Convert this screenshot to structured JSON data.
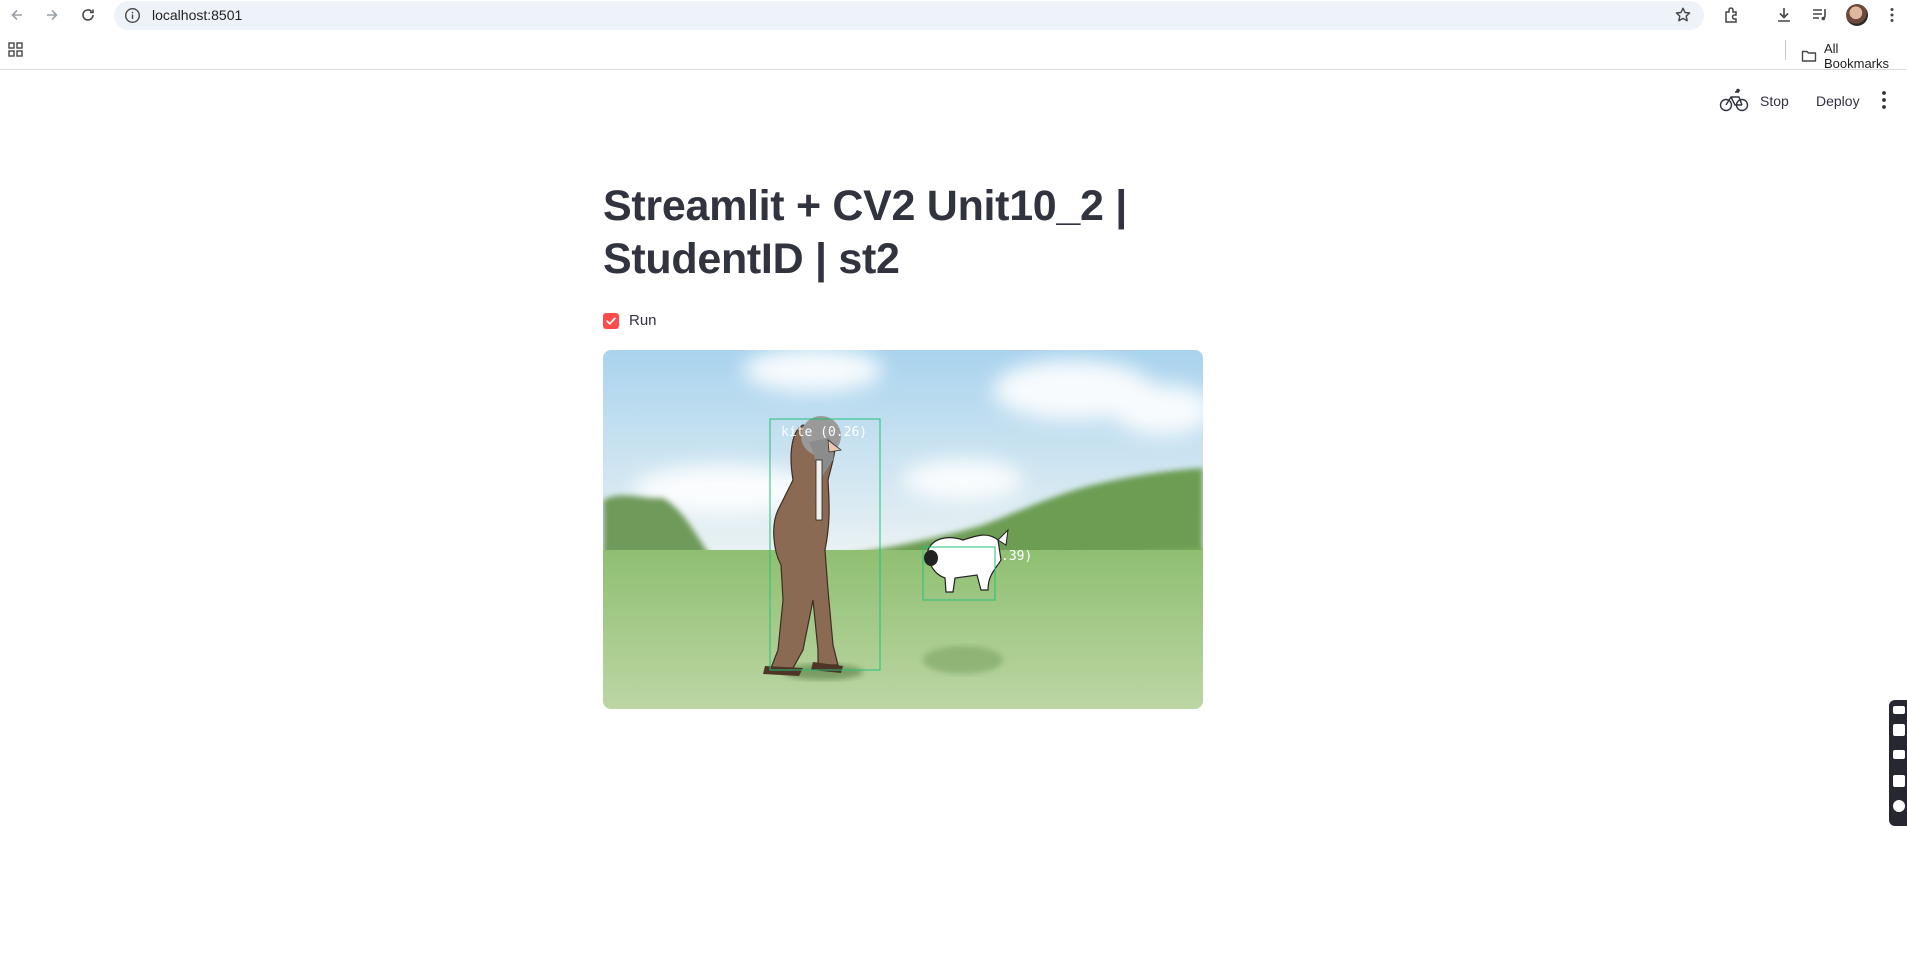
{
  "browser": {
    "url": "localhost:8501",
    "bookmarks_label": "All Bookmarks"
  },
  "header": {
    "stop_label": "Stop",
    "deploy_label": "Deploy"
  },
  "main": {
    "title": "Streamlit + CV2 Unit10_2 | StudentID | st2",
    "checkbox_label": "Run",
    "checkbox_checked": true,
    "accent_color": "#ff4b4b"
  },
  "video_frame": {
    "detections": [
      {
        "label": "kite (0.26)",
        "color": "#22c07a"
      },
      {
        "label": ".39)",
        "color": "#22c07a"
      }
    ]
  }
}
